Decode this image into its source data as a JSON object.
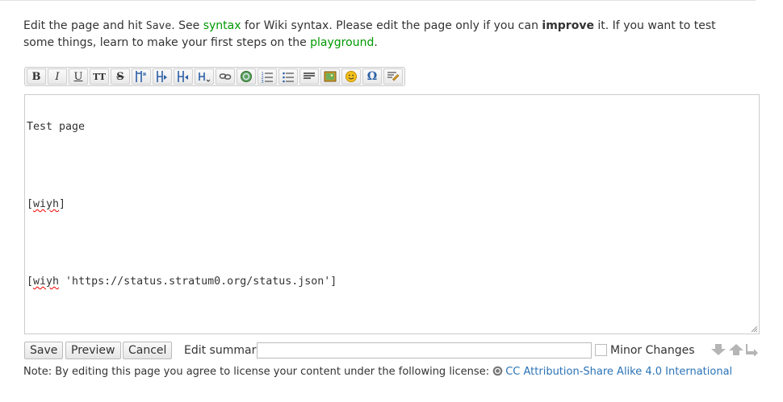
{
  "intro": {
    "text1": "Edit the page and hit ",
    "save_code": "Save",
    "text2": ". See ",
    "syntax_link": "syntax",
    "text3": " for Wiki syntax. Please edit the page only if you can ",
    "improve": "improve",
    "text4": " it. If you want to test some things, learn to make your first steps on the ",
    "playground_link": "playground",
    "text5": "."
  },
  "toolbar": {
    "buttons": [
      {
        "name": "bold",
        "glyph": "B"
      },
      {
        "name": "italic",
        "glyph": "I"
      },
      {
        "name": "underline",
        "glyph": "U"
      },
      {
        "name": "monospace",
        "glyph": "TT"
      },
      {
        "name": "strikethrough",
        "glyph": "S"
      },
      {
        "name": "same-level-headline"
      },
      {
        "name": "lower-headline"
      },
      {
        "name": "higher-headline"
      },
      {
        "name": "headline-menu"
      },
      {
        "name": "internal-link"
      },
      {
        "name": "external-link"
      },
      {
        "name": "ordered-list"
      },
      {
        "name": "unordered-list"
      },
      {
        "name": "horizontal-rule"
      },
      {
        "name": "add-images"
      },
      {
        "name": "smileys"
      },
      {
        "name": "special-chars",
        "glyph": "Ω"
      },
      {
        "name": "insert-signature"
      }
    ]
  },
  "editor": {
    "line1": "Test page",
    "line3_open": "[",
    "line3_word": "wiyh",
    "line3_close": "]",
    "line5_open": "[",
    "line5_word": "wiyh",
    "line5_rest": " 'https://status.stratum0.org/status.json']"
  },
  "form": {
    "save_label": "Save",
    "preview_label": "Preview",
    "cancel_label": "Cancel",
    "summary_label": "Edit summary",
    "summary_value": "",
    "minor_label": "Minor Changes",
    "minor_checked": false
  },
  "license": {
    "text": "Note: By editing this page you agree to license your content under the following license: ",
    "link": "CC Attribution-Share Alike 4.0 International"
  },
  "colors": {
    "link_blue": "#2b73b7",
    "wikilink_green": "#009900",
    "squiggle_red": "#ee0000"
  }
}
